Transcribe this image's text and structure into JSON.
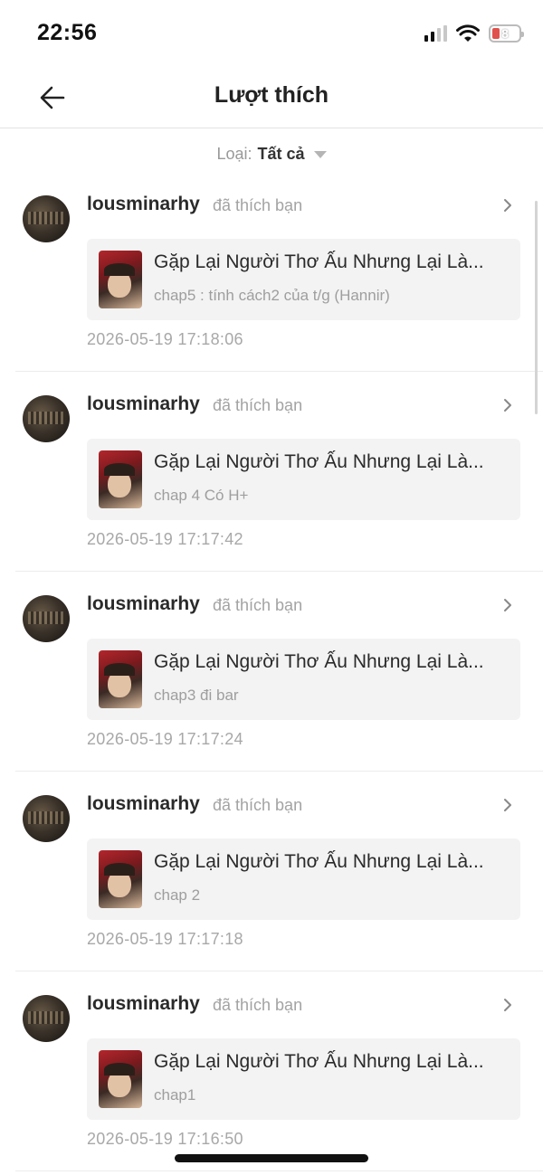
{
  "status_bar": {
    "time": "22:56",
    "battery_level": "8",
    "signal_icon": "cellular-signal-icon",
    "wifi_icon": "wifi-icon",
    "battery_icon": "battery-icon",
    "battery_color": "#e0524d"
  },
  "header": {
    "title": "Lượt thích",
    "back_icon": "arrow-left-icon"
  },
  "filter": {
    "label": "Loại:",
    "value": "Tất cả",
    "caret_icon": "caret-down-icon"
  },
  "items": [
    {
      "username": "lousminarhy",
      "action": "đã thích bạn",
      "story_title": "Gặp Lại Người Thơ Ấu Nhưng Lại Là...",
      "chapter": "chap5 : tính cách2 của t/g (Hannir)",
      "timestamp": "2026-05-19 17:18:06"
    },
    {
      "username": "lousminarhy",
      "action": "đã thích bạn",
      "story_title": "Gặp Lại Người Thơ Ấu Nhưng Lại Là...",
      "chapter": "chap 4 Có H+",
      "timestamp": "2026-05-19 17:17:42"
    },
    {
      "username": "lousminarhy",
      "action": "đã thích bạn",
      "story_title": "Gặp Lại Người Thơ Ấu Nhưng Lại Là...",
      "chapter": "chap3 đi bar",
      "timestamp": "2026-05-19 17:17:24"
    },
    {
      "username": "lousminarhy",
      "action": "đã thích bạn",
      "story_title": "Gặp Lại Người Thơ Ấu Nhưng Lại Là...",
      "chapter": "chap 2",
      "timestamp": "2026-05-19 17:17:18"
    },
    {
      "username": "lousminarhy",
      "action": "đã thích bạn",
      "story_title": "Gặp Lại Người Thơ Ấu Nhưng Lại Là...",
      "chapter": "chap1",
      "timestamp": "2026-05-19 17:16:50"
    }
  ]
}
